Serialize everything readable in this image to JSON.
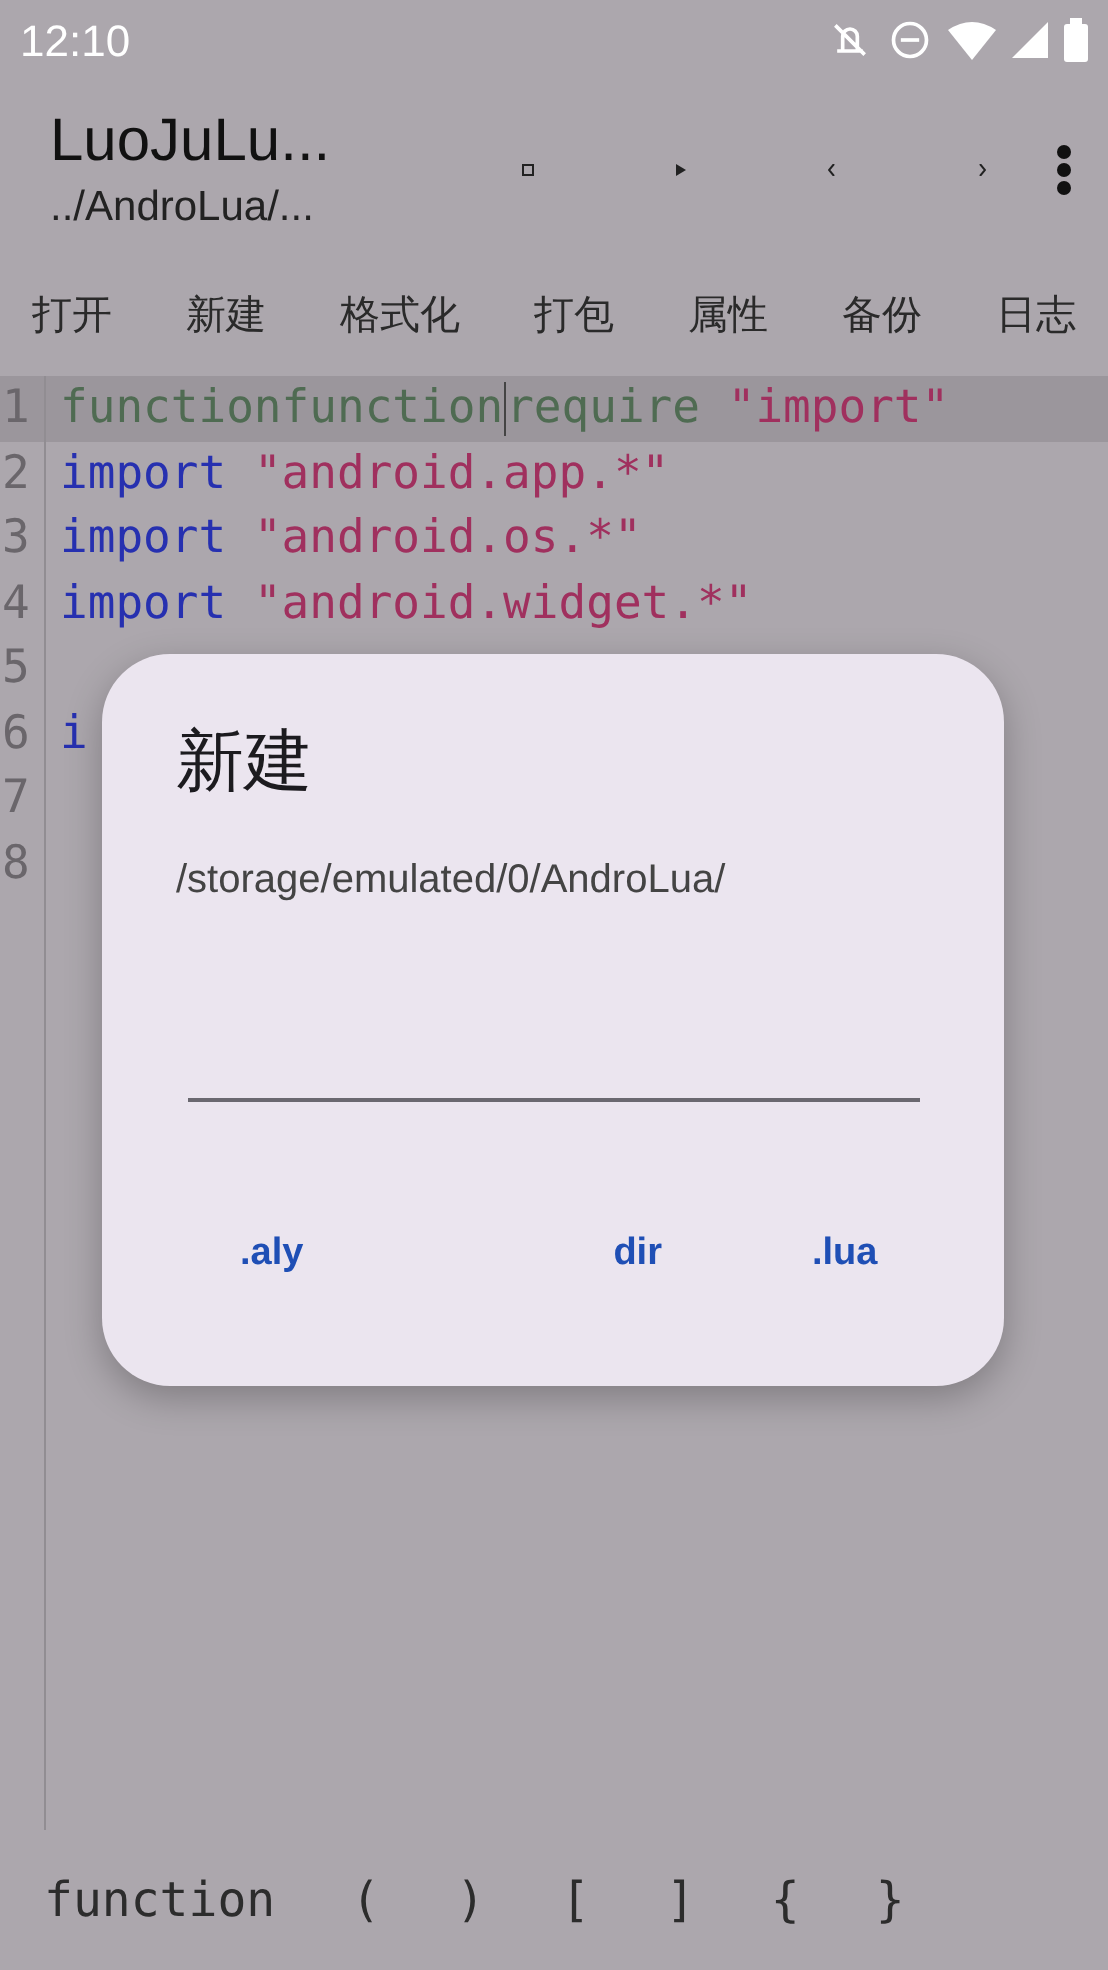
{
  "status_bar": {
    "time": "12:10"
  },
  "app_bar": {
    "title": "LuoJuLu...",
    "subtitle": "../AndroLua/..."
  },
  "menu": [
    "打开",
    "新建",
    "格式化",
    "打包",
    "属性",
    "备份",
    "日志"
  ],
  "editor": {
    "lines": [
      {
        "number": "1",
        "current": true,
        "tokens": [
          {
            "kind": "plain",
            "text": "functionfunction"
          },
          {
            "kind": "cursor"
          },
          {
            "kind": "plain",
            "text": "require "
          },
          {
            "kind": "string",
            "text": "\"import\""
          }
        ]
      },
      {
        "number": "2",
        "current": false,
        "tokens": [
          {
            "kind": "keyword",
            "text": "import "
          },
          {
            "kind": "string",
            "text": "\"android.app.*\""
          }
        ]
      },
      {
        "number": "3",
        "current": false,
        "tokens": [
          {
            "kind": "keyword",
            "text": "import "
          },
          {
            "kind": "string",
            "text": "\"android.os.*\""
          }
        ]
      },
      {
        "number": "4",
        "current": false,
        "tokens": [
          {
            "kind": "keyword",
            "text": "import "
          },
          {
            "kind": "string",
            "text": "\"android.widget.*\""
          }
        ]
      },
      {
        "number": "5",
        "current": false
      },
      {
        "number": "6",
        "current": false,
        "tokens": [
          {
            "kind": "keyword",
            "text": "i"
          }
        ]
      },
      {
        "number": "7",
        "current": false
      },
      {
        "number": "8",
        "current": false
      }
    ]
  },
  "dialog": {
    "title": "新建",
    "message": "/storage/emulated/0/AndroLua/",
    "buttons": [
      ".aly",
      "dir",
      ".lua"
    ]
  },
  "symbols": [
    "function",
    "(",
    ")",
    "[",
    "]",
    "{",
    "}"
  ]
}
